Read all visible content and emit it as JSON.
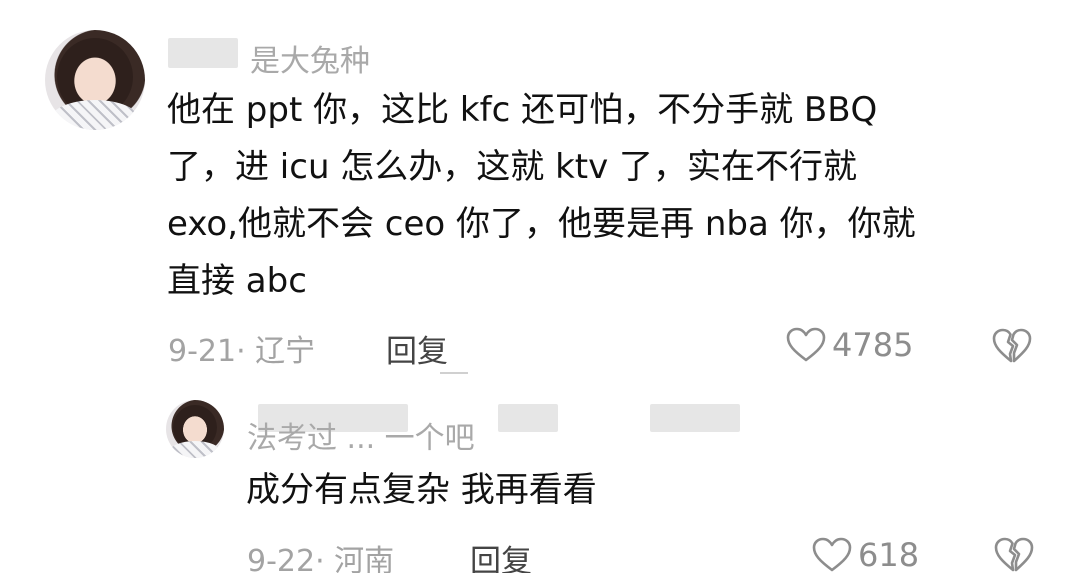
{
  "main_comment": {
    "username": "是大兔种",
    "lines": [
      "他在 ppt 你，这比 kfc 还可怕，不分手就 BBQ",
      "了，进 icu 怎么办，这就 ktv 了，实在不行就",
      "exo,他就不会 ceo 你了，他要是再 nba 你，你就",
      "直接 abc"
    ],
    "date_location": "9-21· 辽宁",
    "reply_label": "回复",
    "like_count": "4785"
  },
  "reply_comment": {
    "username": "法考过 ... 一个吧",
    "text": "成分有点复杂 我再看看",
    "date_location": "9-22· 河南",
    "reply_label": "回复",
    "like_count": "618"
  }
}
